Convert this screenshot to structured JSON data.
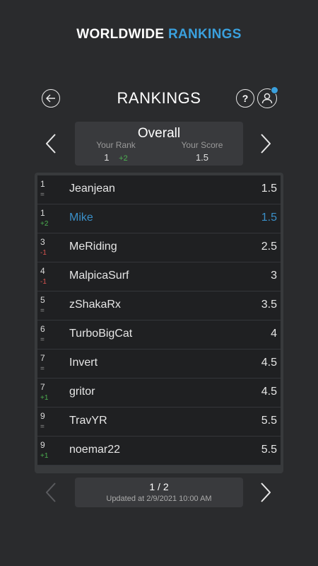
{
  "banner": {
    "word1": "WORLDWIDE",
    "word2": "RANKINGS"
  },
  "header": {
    "title": "RANKINGS",
    "help_label": "?"
  },
  "summary": {
    "title": "Overall",
    "rank_label": "Your Rank",
    "rank_value": "1",
    "rank_delta": "+2",
    "score_label": "Your Score",
    "score_value": "1.5"
  },
  "rankings": [
    {
      "rank": "1",
      "change": "=",
      "name": "Jeanjean",
      "score": "1.5",
      "trend": "same",
      "me": false
    },
    {
      "rank": "1",
      "change": "+2",
      "name": "Mike",
      "score": "1.5",
      "trend": "up",
      "me": true
    },
    {
      "rank": "3",
      "change": "-1",
      "name": "MeRiding",
      "score": "2.5",
      "trend": "down",
      "me": false
    },
    {
      "rank": "4",
      "change": "-1",
      "name": "MalpicaSurf",
      "score": "3",
      "trend": "down",
      "me": false
    },
    {
      "rank": "5",
      "change": "=",
      "name": "zShakaRx",
      "score": "3.5",
      "trend": "same",
      "me": false
    },
    {
      "rank": "6",
      "change": "=",
      "name": "TurboBigCat",
      "score": "4",
      "trend": "same",
      "me": false
    },
    {
      "rank": "7",
      "change": "=",
      "name": "Invert",
      "score": "4.5",
      "trend": "same",
      "me": false
    },
    {
      "rank": "7",
      "change": "+1",
      "name": "gritor",
      "score": "4.5",
      "trend": "up",
      "me": false
    },
    {
      "rank": "9",
      "change": "=",
      "name": "TravYR",
      "score": "5.5",
      "trend": "same",
      "me": false
    },
    {
      "rank": "9",
      "change": "+1",
      "name": "noemar22",
      "score": "5.5",
      "trend": "up",
      "me": false
    }
  ],
  "pager": {
    "page": "1 / 2",
    "updated": "Updated at 2/9/2021 10:00 AM"
  },
  "colors": {
    "accent": "#3aa0dd",
    "up": "#4caf50",
    "down": "#d9534f",
    "background": "#2a2b2d"
  }
}
